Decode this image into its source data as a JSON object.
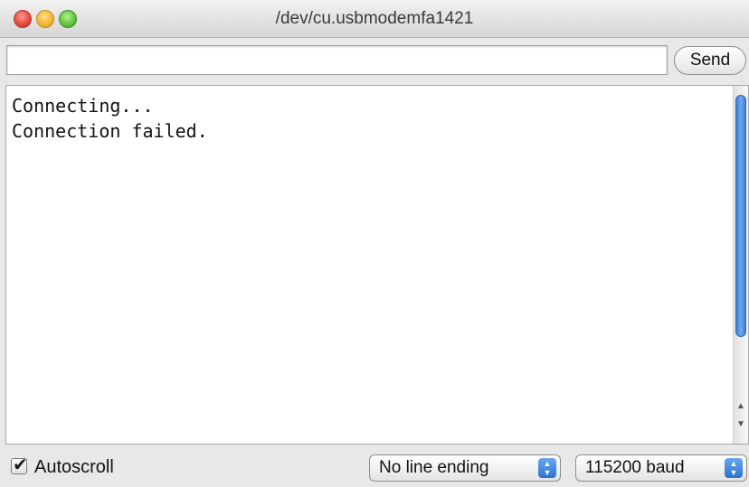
{
  "window": {
    "title": "/dev/cu.usbmodemfa1421"
  },
  "input": {
    "value": "",
    "send_label": "Send"
  },
  "output": {
    "lines": [
      "Connecting...",
      "Connection failed."
    ]
  },
  "footer": {
    "autoscroll_label": "Autoscroll",
    "autoscroll_checked": true,
    "line_ending_selected": "No line ending",
    "baud_selected": "115200 baud"
  },
  "colors": {
    "close": "#e2463b",
    "minimize": "#f2b42c",
    "zoom": "#5cc23a",
    "scroll_thumb": "#3b7fd6"
  },
  "icons": {
    "close": "close-icon",
    "minimize": "minimize-icon",
    "zoom": "zoom-icon",
    "checkbox": "checkmark-icon",
    "select": "updown-arrows-icon"
  }
}
